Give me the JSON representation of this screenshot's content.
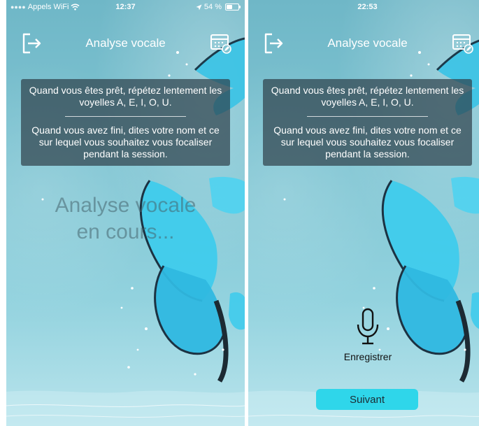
{
  "left_screen": {
    "status_bar": {
      "carrier": "Appels WiFi",
      "time": "12:37",
      "battery_percent": "54 %",
      "battery_level": 54,
      "icons": [
        "signal-dots-icon",
        "wifi-icon",
        "location-arrow-icon",
        "battery-icon"
      ]
    },
    "header": {
      "title": "Analyse vocale"
    },
    "instructions": {
      "line1": "Quand vous êtes prêt, répétez lentement les voyelles A, E, I, O, U.",
      "line2": "Quand vous avez fini, dites votre nom et ce sur lequel vous souhaitez vous focaliser pendant la session."
    },
    "status_message": {
      "line1": "Analyse vocale",
      "line2": "en cours..."
    }
  },
  "right_screen": {
    "status_bar": {
      "time": "22:53"
    },
    "header": {
      "title": "Analyse vocale"
    },
    "instructions": {
      "line1": "Quand vous êtes prêt, répétez lentement les voyelles A, E, I, O, U.",
      "line2": "Quand vous avez fini, dites votre nom et ce sur lequel vous souhaitez vous focaliser pendant la session."
    },
    "record_button": {
      "label": "Enregistrer",
      "icon": "microphone-icon"
    },
    "next_button": {
      "label": "Suivant"
    }
  },
  "icons": {
    "logout": "logout-arrow-icon",
    "calendar": "calendar-edit-icon"
  },
  "colors": {
    "background_top": "#6fb7c7",
    "background_bottom": "#b9e4ec",
    "instructions_panel": "#2d3e48",
    "next_button": "#2fd6ea",
    "butterfly": "#3fc8e8",
    "text_light": "#ffffff"
  }
}
